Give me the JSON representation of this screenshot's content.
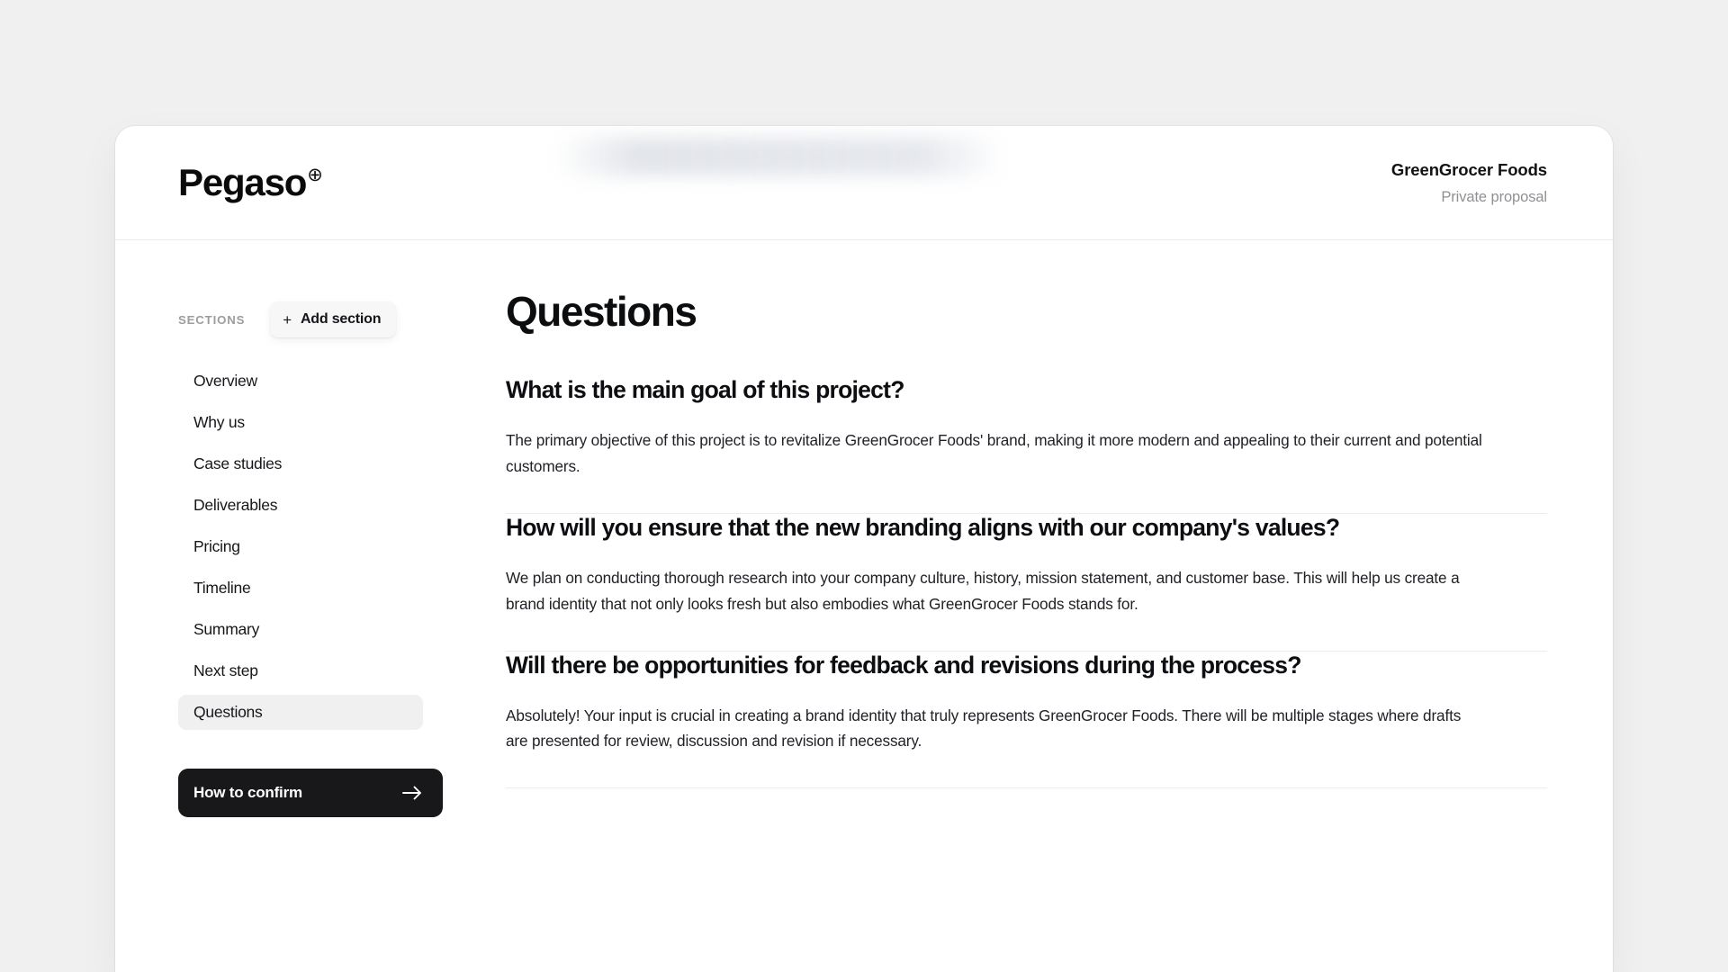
{
  "app": {
    "background_color": "#f0f0f1",
    "card_background": "#ffffff"
  },
  "header": {
    "brand_name": "Pegaso",
    "brand_mark": "⊕",
    "client_name": "GreenGrocer Foods",
    "client_subtitle": "Private proposal"
  },
  "sidebar": {
    "sections_label": "SECTIONS",
    "add_section_label": "Add section",
    "add_section_icon": "plus-icon",
    "items": [
      {
        "label": "Overview",
        "active": false
      },
      {
        "label": "Why us",
        "active": false
      },
      {
        "label": "Case studies",
        "active": false
      },
      {
        "label": "Deliverables",
        "active": false
      },
      {
        "label": "Pricing",
        "active": false
      },
      {
        "label": "Timeline",
        "active": false
      },
      {
        "label": "Summary",
        "active": false
      },
      {
        "label": "Next step",
        "active": false
      },
      {
        "label": "Questions",
        "active": true
      }
    ],
    "confirm_button": {
      "label": "How to confirm",
      "icon": "arrow-right-icon",
      "background_color": "#18181a",
      "text_color": "#ffffff"
    }
  },
  "main": {
    "title": "Questions",
    "qa": [
      {
        "question": "What is the main goal of this project?",
        "answer": "The primary objective of this project is to revitalize GreenGrocer Foods' brand, making it more modern and appealing to their current and potential customers."
      },
      {
        "question": "How will you ensure that the new branding aligns with our company's values?",
        "answer": "We plan on conducting thorough research into your company culture, history, mission statement, and customer base. This will help us create a brand identity that not only looks fresh but also embodies what GreenGrocer Foods stands for."
      },
      {
        "question": "Will there be opportunities for feedback and revisions during the process?",
        "answer": "Absolutely! Your input is crucial in creating a brand identity that truly represents GreenGrocer Foods. There will be multiple stages where drafts are presented for review, discussion and revision if necessary."
      }
    ]
  }
}
